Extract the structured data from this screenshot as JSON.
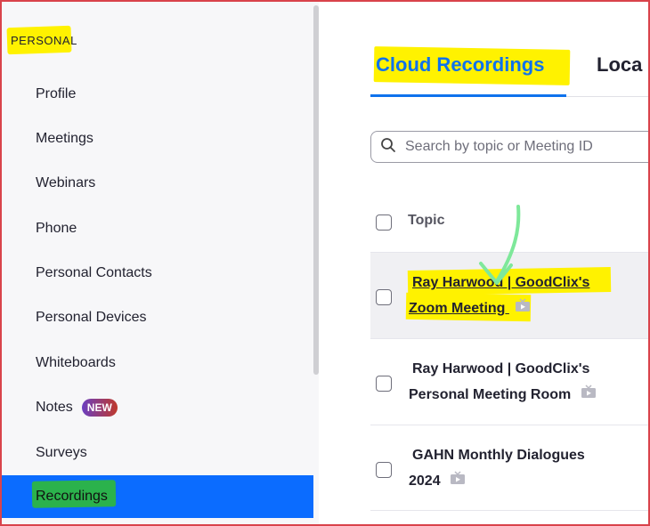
{
  "sidebar": {
    "section_label": "PERSONAL",
    "items": [
      {
        "label": "Profile"
      },
      {
        "label": "Meetings"
      },
      {
        "label": "Webinars"
      },
      {
        "label": "Phone"
      },
      {
        "label": "Personal Contacts"
      },
      {
        "label": "Personal Devices"
      },
      {
        "label": "Whiteboards"
      },
      {
        "label": "Notes",
        "badge": "NEW"
      },
      {
        "label": "Surveys"
      },
      {
        "label": "Recordings",
        "active": true
      }
    ]
  },
  "main": {
    "tabs": [
      {
        "label": "Cloud Recordings",
        "active": true
      },
      {
        "label": "Loca"
      }
    ],
    "search": {
      "placeholder": "Search by topic or Meeting ID",
      "icon": "search-icon"
    },
    "table": {
      "header": {
        "topic": "Topic"
      },
      "rows": [
        {
          "line1": "Ray Harwood | GoodClix's",
          "line2": "Zoom Meeting",
          "icon": "tv-icon"
        },
        {
          "line1": "Ray Harwood | GoodClix's",
          "line2": "Personal Meeting Room",
          "icon": "tv-icon"
        },
        {
          "line1": "GAHN Monthly Dialogues",
          "line2": "2024",
          "icon": "tv-icon"
        }
      ]
    }
  },
  "colors": {
    "accent": "#0e72ed",
    "active_nav": "#0b6cff",
    "highlight_yellow": "#fff200",
    "highlight_green": "#2bb24c",
    "annotation_arrow": "#7ee89a",
    "border": "#d9434b"
  }
}
